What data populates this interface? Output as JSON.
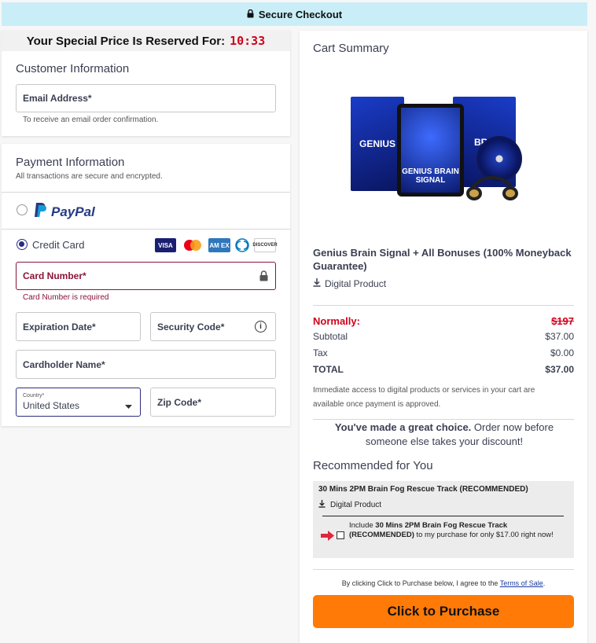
{
  "header": {
    "title": "Secure Checkout"
  },
  "timer": {
    "label": "Your Special Price Is Reserved For:",
    "time": "10:33"
  },
  "customer": {
    "title": "Customer Information",
    "email_label": "Email Address*",
    "email_help": "To receive an email order confirmation."
  },
  "payment": {
    "title": "Payment Information",
    "subtitle": "All transactions are secure and encrypted.",
    "paypal_label": "PayPal",
    "credit_label": "Credit Card",
    "cards": [
      "VISA",
      "MC",
      "AMEX",
      "DINERS",
      "DISCOVER"
    ],
    "card_number_label": "Card Number*",
    "card_number_error": "Card Number is required",
    "expiration_label": "Expiration Date*",
    "security_label": "Security Code*",
    "cardholder_label": "Cardholder Name*",
    "country_small": "Country*",
    "country_value": "United States",
    "zip_label": "Zip Code*"
  },
  "summary": {
    "title": "Cart Summary",
    "product_name": "Genius Brain Signal + All Bonuses (100% Moneyback Guarantee)",
    "product_type": "Digital Product",
    "box_left_text": "GENIUS",
    "tablet_text": "GENIUS BRAIN SIGNAL",
    "box_right_text": "BRA",
    "normally_label": "Normally:",
    "normally_value": "$197",
    "subtotal_label": "Subtotal",
    "subtotal_value": "$37.00",
    "tax_label": "Tax",
    "tax_value": "$0.00",
    "total_label": "TOTAL",
    "total_value": "$37.00",
    "access_note": "Immediate access to digital products or services in your cart are available once payment is approved.",
    "choice_bold": "You've made a great choice.",
    "choice_rest": " Order now before someone else takes your discount!"
  },
  "recommended": {
    "title": "Recommended for You",
    "item_name": "30 Mins 2PM Brain Fog Rescue Track (RECOMMENDED)",
    "item_type": "Digital Product",
    "include_prefix": "Include ",
    "include_bold": "30 Mins 2PM Brain Fog Rescue Track (RECOMMENDED)",
    "include_suffix": " to my purchase for only $17.00 right now!"
  },
  "footer": {
    "terms_prefix": "By clicking Click to Purchase below, I agree to the ",
    "terms_link": "Terms of Sale",
    "terms_suffix": ".",
    "purchase_button": "Click to Purchase"
  },
  "colors": {
    "accent": "#ff7a06",
    "error": "#8a1538",
    "banner": "#c9eef8",
    "strike": "#d0021b"
  }
}
